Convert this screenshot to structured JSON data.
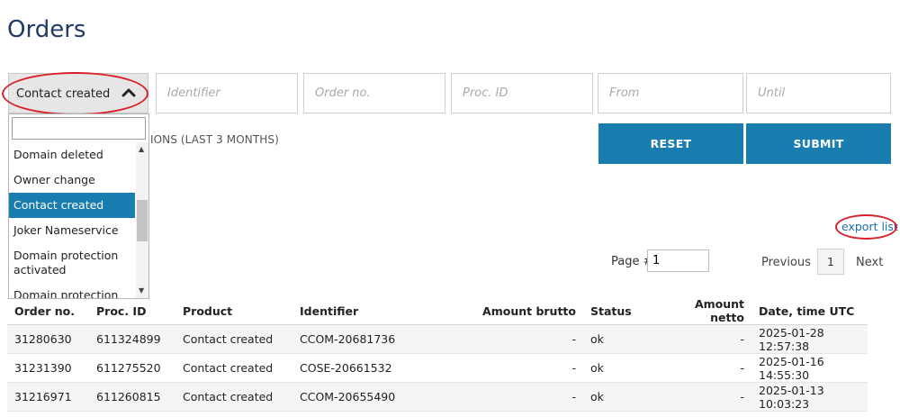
{
  "page_title": "Orders",
  "filters": {
    "type_selected": "Contact created",
    "identifier_placeholder": "Identifier",
    "order_no_placeholder": "Order no.",
    "proc_id_placeholder": "Proc. ID",
    "from_placeholder": "From",
    "until_placeholder": "Until",
    "caption": "IONS (LAST 3 MONTHS)",
    "reset_label": "RESET",
    "submit_label": "SUBMIT"
  },
  "dropdown": {
    "items": [
      {
        "label": "Domain deleted"
      },
      {
        "label": "Owner change"
      },
      {
        "label": "Contact created"
      },
      {
        "label": "Joker Nameservice"
      },
      {
        "label": "Domain protection activated"
      },
      {
        "label": "Domain protection"
      }
    ],
    "active_index": 2
  },
  "export_label": "export list",
  "pagination": {
    "page_label": "Page #",
    "page_value": "1",
    "previous_label": "Previous",
    "current_page": "1",
    "next_label": "Next"
  },
  "table": {
    "headers": [
      "Order no.",
      "Proc. ID",
      "Product",
      "Identifier",
      "Amount brutto",
      "Status",
      "Amount netto",
      "Date, time UTC"
    ],
    "rows": [
      [
        "31280630",
        "611324899",
        "Contact created",
        "CCOM-20681736",
        "-",
        "ok",
        "-",
        "2025-01-28 12:57:38"
      ],
      [
        "31231390",
        "611275520",
        "Contact created",
        "COSE-20661532",
        "-",
        "ok",
        "-",
        "2025-01-16 14:55:30"
      ],
      [
        "31216971",
        "611260815",
        "Contact created",
        "CCOM-20655490",
        "-",
        "ok",
        "-",
        "2025-01-13 10:03:23"
      ]
    ]
  },
  "colors": {
    "accent": "#1a7db0",
    "title": "#1f3b66",
    "highlight_ring": "#d8202a"
  }
}
